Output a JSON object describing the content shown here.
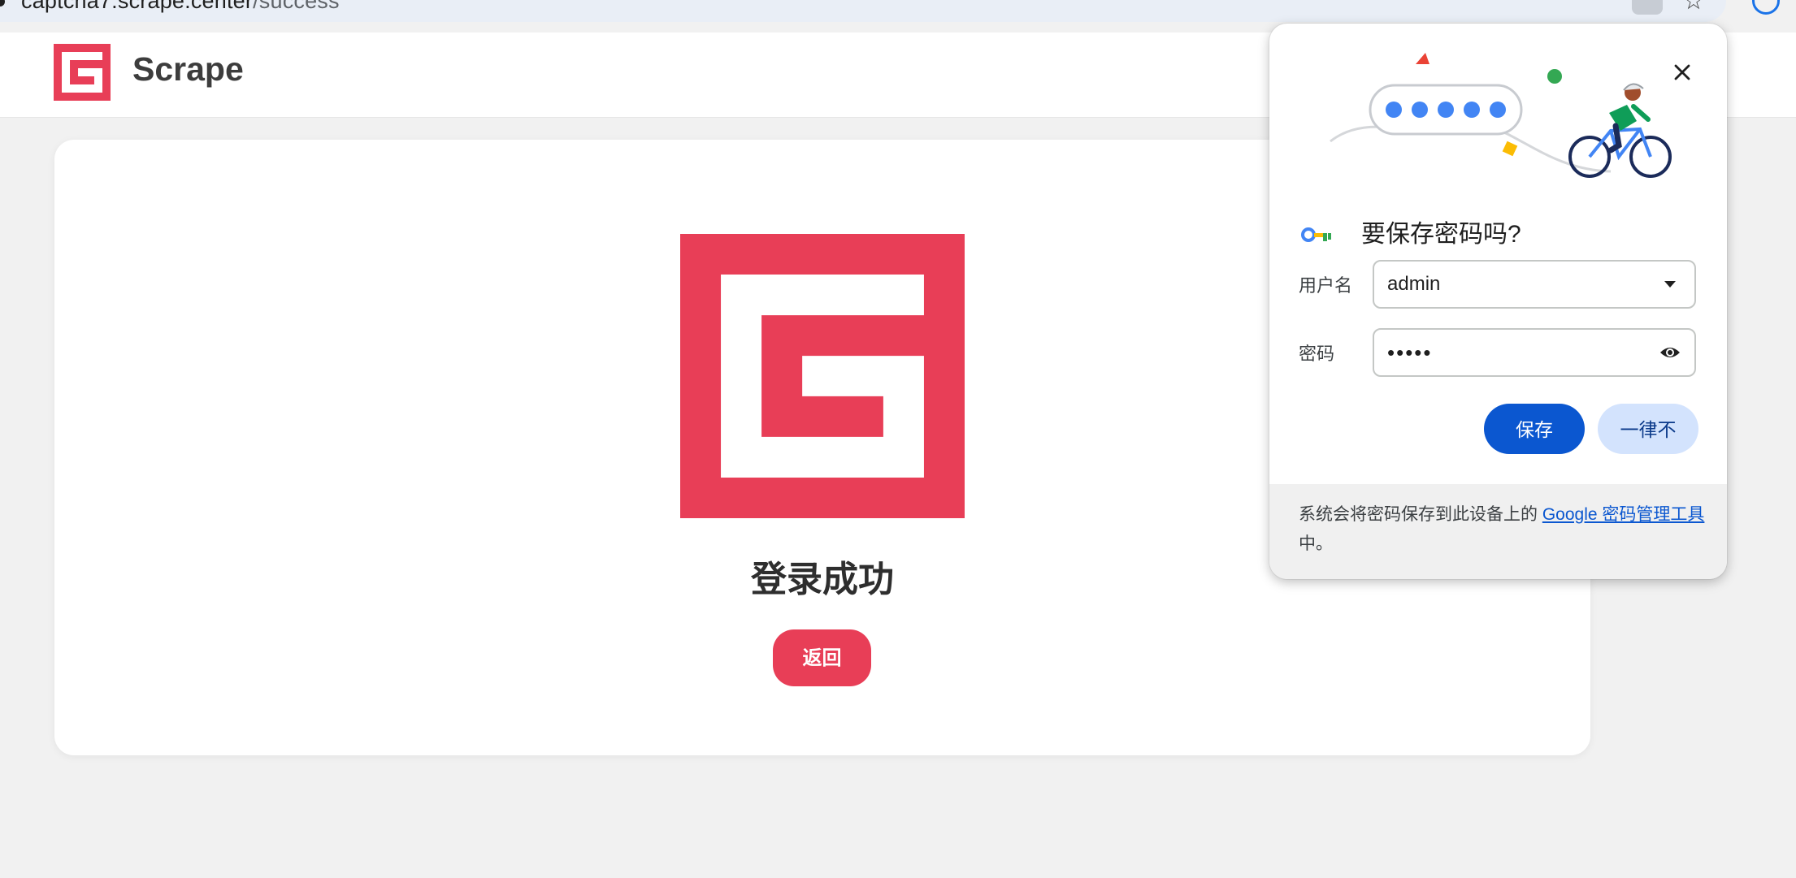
{
  "browser": {
    "url_host": "captcha7.scrape.center",
    "url_path": "/success",
    "icons": [
      "password-key-icon",
      "star-icon",
      "profile-icon"
    ]
  },
  "site": {
    "brand": "Scrape",
    "brand_color": "#e83e57",
    "logo_icon": "g-logo-icon"
  },
  "main": {
    "title": "登录成功",
    "back_label": "返回"
  },
  "password_popup": {
    "title": "要保存密码吗?",
    "username_label": "用户名",
    "username_value": "admin",
    "password_label": "密码",
    "password_masked": "•••••",
    "save_label": "保存",
    "never_label": "一律不",
    "footer_text_before": "系统会将密码保存到此设备上的 ",
    "footer_link": "Google 密码管理工具",
    "footer_text_after": "中。",
    "accent_color": "#0b57d0"
  }
}
